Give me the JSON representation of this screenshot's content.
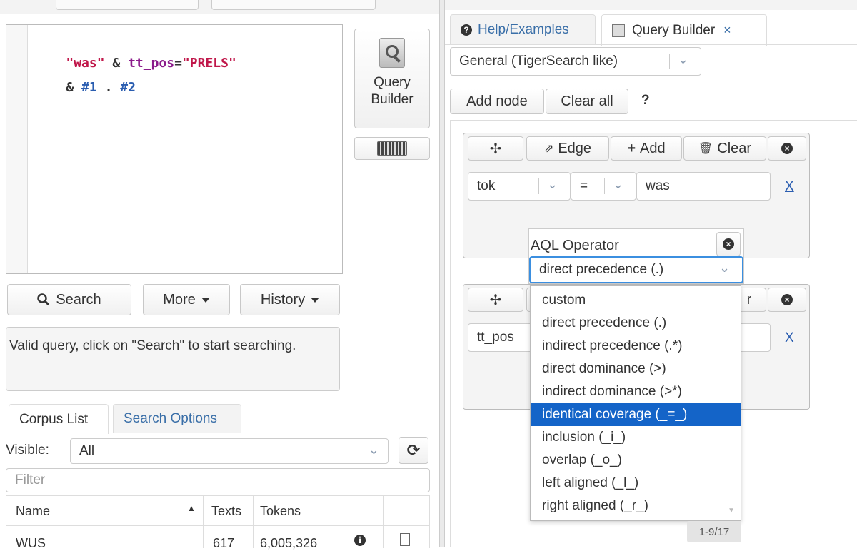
{
  "editor": {
    "line1_str": "\"was\"",
    "line1_amp": " & ",
    "line1_kw": "tt_pos",
    "line1_eq": "=",
    "line1_val": "\"PRELS\"",
    "line2_amp": "& ",
    "line2_ref1": "#1",
    "line2_dot": " . ",
    "line2_ref2": "#2"
  },
  "side": {
    "query_builder_line1": "Query",
    "query_builder_line2": "Builder"
  },
  "actions": {
    "search": "Search",
    "more": "More",
    "history": "History"
  },
  "status": {
    "message": "Valid query, click on \"Search\" to start searching."
  },
  "left_tabs": {
    "corpus_list": "Corpus List",
    "search_options": "Search Options"
  },
  "corpus": {
    "visible_label": "Visible:",
    "visible_value": "All",
    "filter_placeholder": "Filter",
    "columns": [
      "Name",
      "Texts",
      "Tokens"
    ],
    "rows": [
      {
        "name": "WUS",
        "texts": "617",
        "tokens": "6,005,326"
      }
    ]
  },
  "right_tabs": {
    "help": "Help/Examples",
    "query_builder": "Query Builder",
    "close": "×"
  },
  "builder": {
    "mode": "General (TigerSearch like)",
    "add_node": "Add node",
    "clear_all": "Clear all",
    "help": "?",
    "node1": {
      "edge": "Edge",
      "add": "Add",
      "clear": "Clear",
      "attr": "tok",
      "op": "=",
      "value": "was",
      "remove": "X"
    },
    "node2": {
      "clear_partial": "r",
      "attr": "tt_pos",
      "remove": "X"
    },
    "aql": {
      "title": "AQL Operator",
      "selected": "direct precedence (.)",
      "options": [
        "custom",
        "direct precedence (.)",
        "indirect precedence (.*)",
        "direct dominance (>)",
        "indirect dominance (>*)",
        "identical coverage (_=_)",
        "inclusion (_i_)",
        "overlap (_o_)",
        "left aligned (_l_)",
        "right aligned (_r_)"
      ],
      "highlighted_index": 5
    },
    "pager": "1-9/17"
  }
}
